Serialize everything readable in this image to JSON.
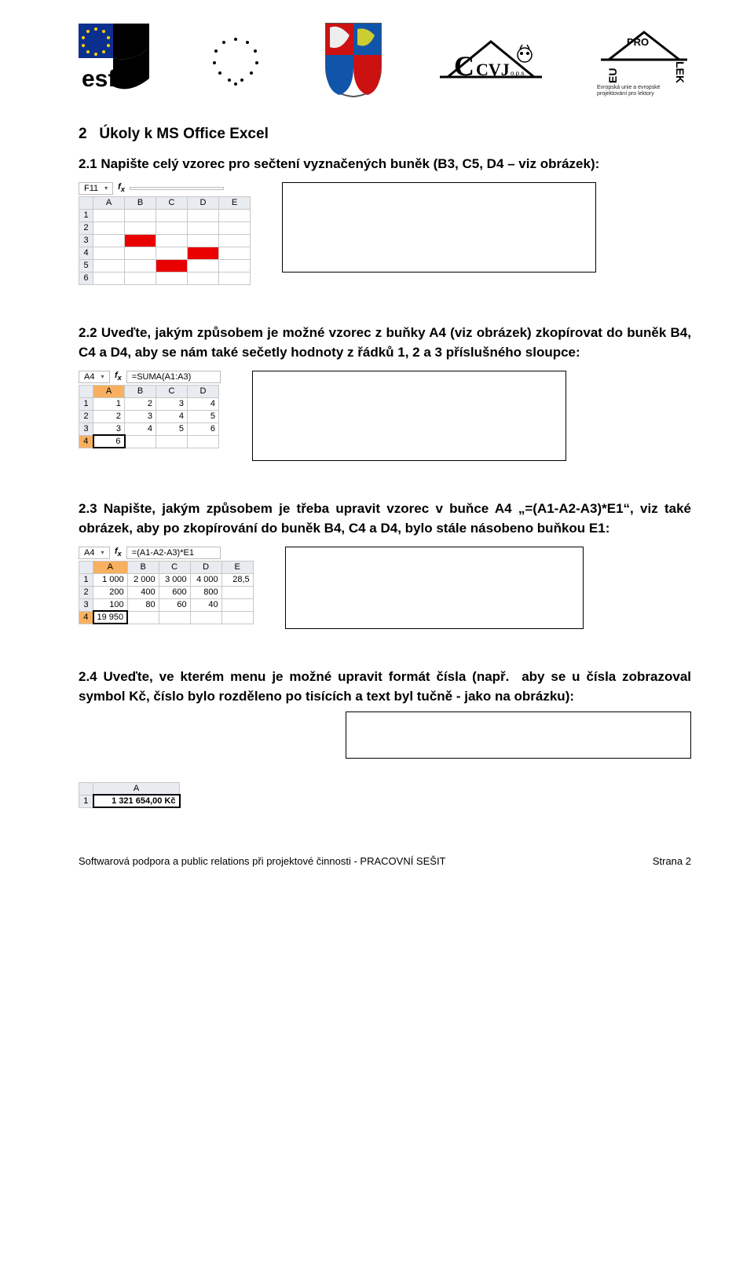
{
  "logos": {
    "esf_label": "esf",
    "eu_caption_line1": "Evropská unie a evropské",
    "eu_caption_line2": "projektování pro lektory",
    "ccvj_label": "CVJ",
    "ccvj_sub": "o.p.s.",
    "eu_pro_lek": "EU PRO LEK"
  },
  "section": {
    "number": "2",
    "title": "Úkoly k MS Office Excel"
  },
  "tasks": {
    "t21": "2.1 Napište celý vzorec pro sečtení vyznačených buněk (B3, C5, D4 – viz obrázek):",
    "t22": "2.2 Uveďte, jakým způsobem je možné vzorec z buňky A4 (viz obrázek) zkopírovat do buněk B4, C4 a D4, aby se nám také sečetly hodnoty z řádků 1, 2 a 3 příslušného sloupce:",
    "t23": "2.3 Napište, jakým způsobem je třeba upravit vzorec v buňce A4 „=(A1-A2-A3)*E1“, viz také obrázek, aby po zkopírování do buněk B4, C4 a D4, bylo stále násobeno buňkou E1:",
    "t24_a": "2.4 Uveďte, ve kterém menu je možné upravit formát čísla (např.",
    "t24_b": "aby se u čísla zobrazoval symbol Kč, číslo bylo rozděleno po tisících a text byl tučně - jako na obrázku):"
  },
  "xl21": {
    "namebox": "F11",
    "cols": [
      "A",
      "B",
      "C",
      "D",
      "E"
    ],
    "rows": [
      "1",
      "2",
      "3",
      "4",
      "5",
      "6"
    ]
  },
  "xl22": {
    "namebox": "A4",
    "formula": "=SUMA(A1:A3)",
    "cols": [
      "A",
      "B",
      "C",
      "D"
    ],
    "rowlabels": [
      "1",
      "2",
      "3",
      "4"
    ],
    "data": [
      [
        "1",
        "2",
        "3",
        "4"
      ],
      [
        "2",
        "3",
        "4",
        "5"
      ],
      [
        "3",
        "4",
        "5",
        "6"
      ]
    ],
    "a4": "6"
  },
  "xl23": {
    "namebox": "A4",
    "formula": "=(A1-A2-A3)*E1",
    "cols": [
      "A",
      "B",
      "C",
      "D",
      "E"
    ],
    "rowlabels": [
      "1",
      "2",
      "3",
      "4"
    ],
    "data": [
      [
        "1 000",
        "2 000",
        "3 000",
        "4 000",
        "28,5"
      ],
      [
        "200",
        "400",
        "600",
        "800",
        ""
      ],
      [
        "100",
        "80",
        "60",
        "40",
        ""
      ]
    ],
    "a4": "19 950"
  },
  "xl24": {
    "col": "A",
    "row": "1",
    "value": "1 321 654,00 Kč"
  },
  "footer": {
    "left": "Softwarová podpora a public relations při projektové činnosti - PRACOVNÍ SEŠIT",
    "right": "Strana 2"
  }
}
